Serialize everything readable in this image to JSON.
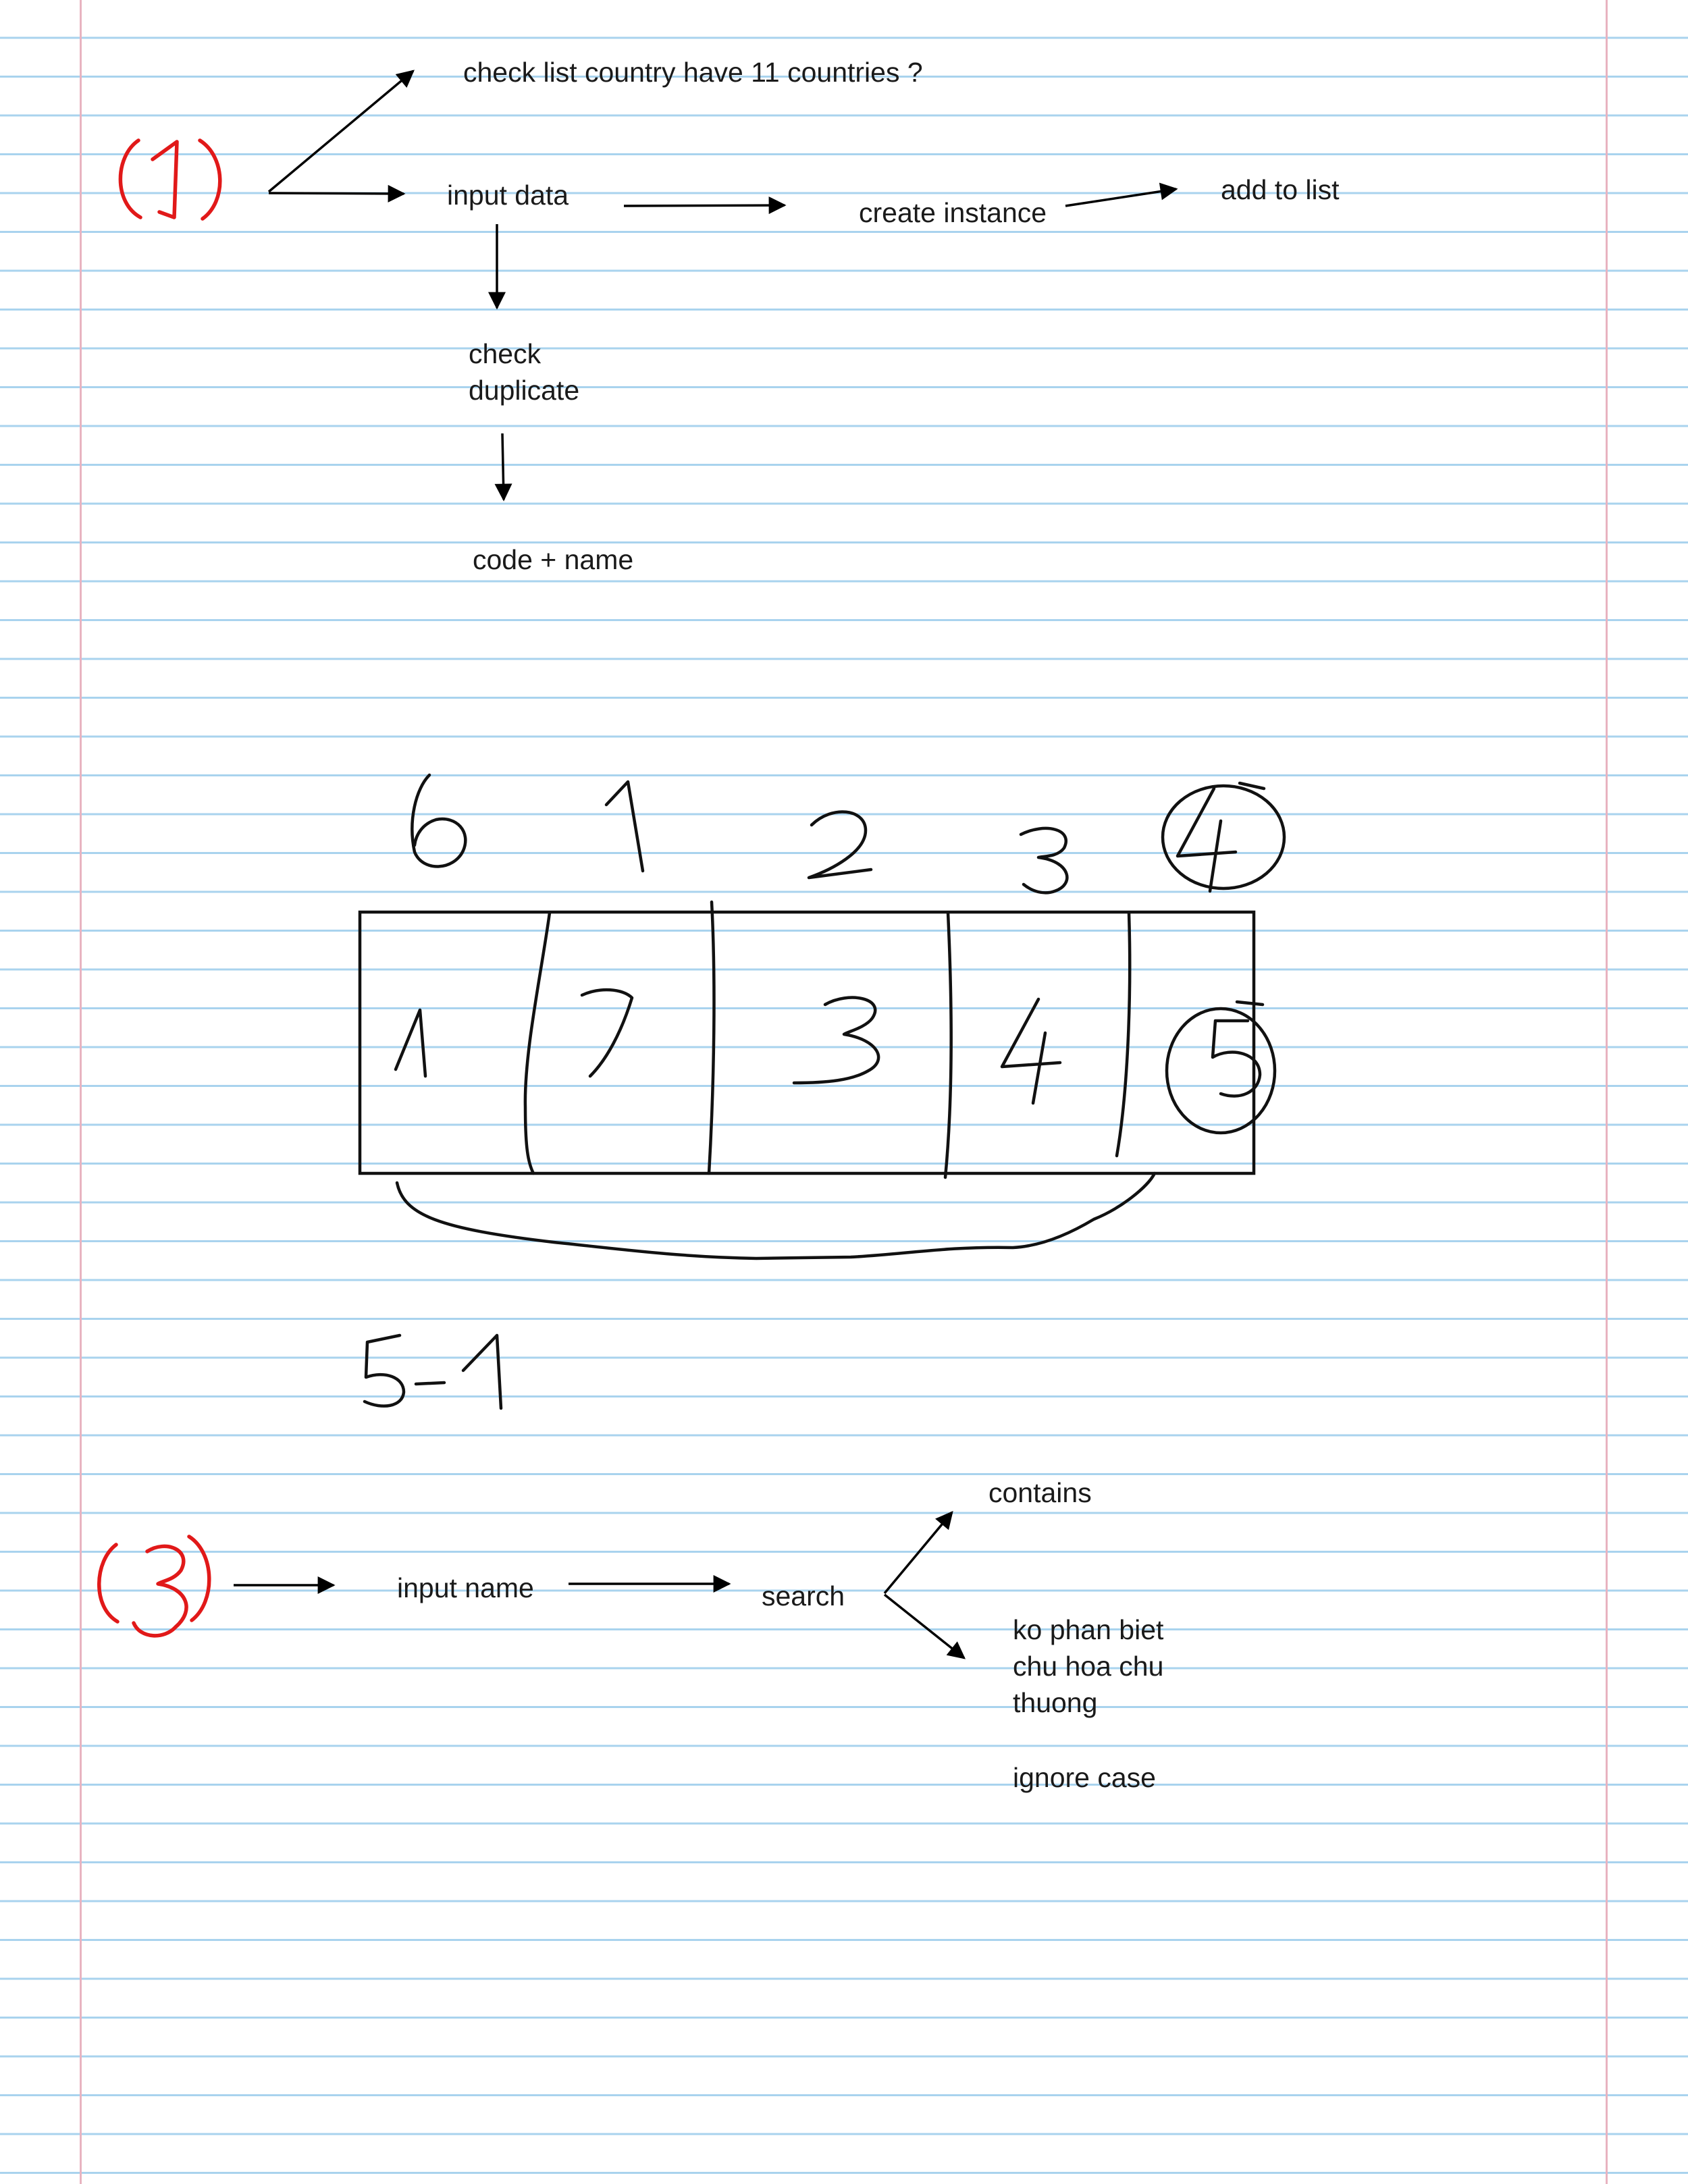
{
  "section1": {
    "marker": "(1)",
    "check_list": "check list country have 11 countries ?",
    "input_data": "input data",
    "create_instance": "create instance",
    "add_to_list": "add to list",
    "check_duplicate": "check duplicate",
    "code_name": "code + name"
  },
  "array_sketch": {
    "indices": [
      "0",
      "1",
      "2",
      "3",
      "4"
    ],
    "values": [
      "1",
      "2",
      "3",
      "4",
      "5"
    ],
    "formula": "5 - 1"
  },
  "section3": {
    "marker": "(3)",
    "input_name": "input name",
    "search": "search",
    "contains": "contains",
    "case_note": "ko phan biet chu hoa chu thuong",
    "ignore_case": "ignore case"
  },
  "colors": {
    "rule_lines": "#a9d3ee",
    "margin_lines": "#e8b3c0",
    "red_ink": "#e11919",
    "black_ink": "#111111"
  }
}
